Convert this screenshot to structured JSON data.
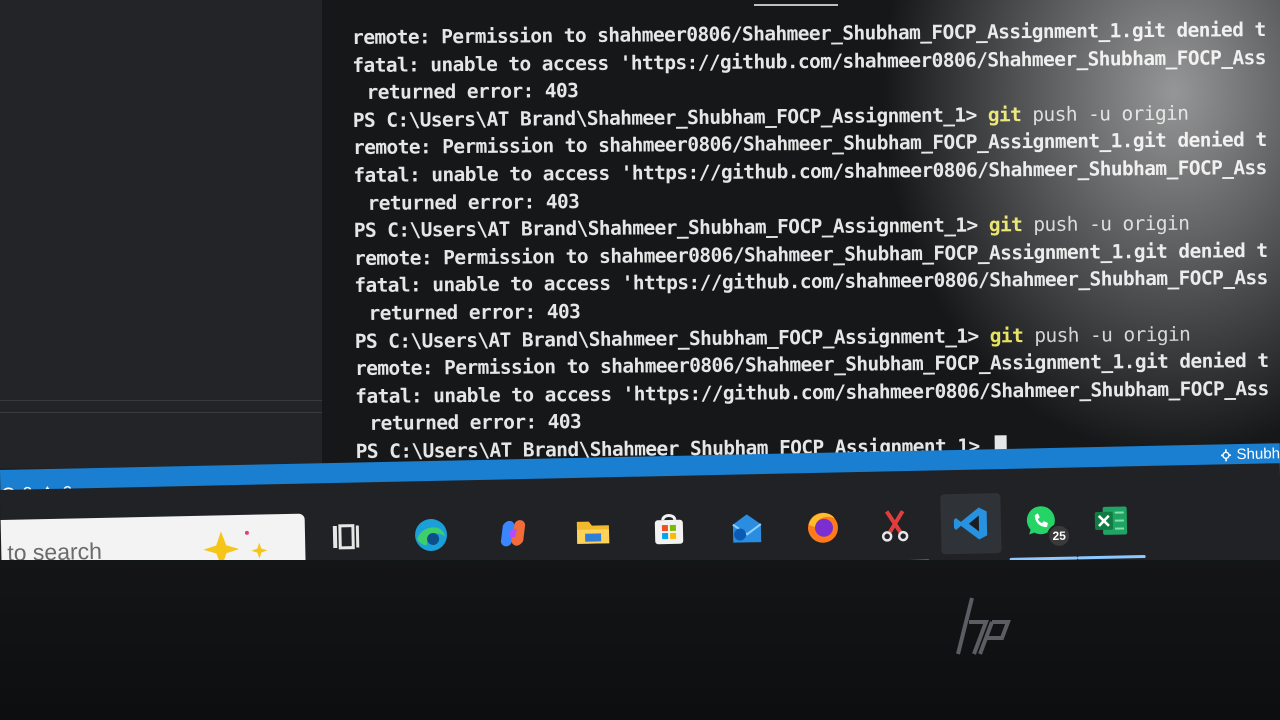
{
  "terminal": {
    "lines": [
      {
        "type": "remote",
        "text": "remote: Permission to shahmeer0806/Shahmeer_Shubham_FOCP_Assignment_1.git denied t"
      },
      {
        "type": "fatal",
        "text": "fatal: unable to access 'https://github.com/shahmeer0806/Shahmeer_Shubham_FOCP_Ass"
      },
      {
        "type": "error",
        "text": "returned error: 403"
      },
      {
        "type": "prompt",
        "prompt": "PS C:\\Users\\AT Brand\\Shahmeer_Shubham_FOCP_Assignment_1> ",
        "keyword": "git",
        "args": " push -u origin"
      },
      {
        "type": "remote",
        "text": "remote: Permission to shahmeer0806/Shahmeer_Shubham_FOCP_Assignment_1.git denied t"
      },
      {
        "type": "fatal",
        "text": "fatal: unable to access 'https://github.com/shahmeer0806/Shahmeer_Shubham_FOCP_Ass"
      },
      {
        "type": "error",
        "text": "returned error: 403"
      },
      {
        "type": "prompt",
        "prompt": "PS C:\\Users\\AT Brand\\Shahmeer_Shubham_FOCP_Assignment_1> ",
        "keyword": "git",
        "args": " push -u origin"
      },
      {
        "type": "remote",
        "text": "remote: Permission to shahmeer0806/Shahmeer_Shubham_FOCP_Assignment_1.git denied t"
      },
      {
        "type": "fatal",
        "text": "fatal: unable to access 'https://github.com/shahmeer0806/Shahmeer_Shubham_FOCP_Ass"
      },
      {
        "type": "error",
        "text": "returned error: 403"
      },
      {
        "type": "prompt",
        "prompt": "PS C:\\Users\\AT Brand\\Shahmeer_Shubham_FOCP_Assignment_1> ",
        "keyword": "git",
        "args": " push -u origin"
      },
      {
        "type": "remote",
        "text": "remote: Permission to shahmeer0806/Shahmeer_Shubham_FOCP_Assignment_1.git denied t"
      },
      {
        "type": "fatal",
        "text": "fatal: unable to access 'https://github.com/shahmeer0806/Shahmeer_Shubham_FOCP_Ass"
      },
      {
        "type": "error",
        "text": "returned error: 403"
      },
      {
        "type": "prompt",
        "prompt": "PS C:\\Users\\AT Brand\\Shahmeer_Shubham_FOCP_Assignment_1> ",
        "keyword": "",
        "args": "",
        "cursor": true
      }
    ]
  },
  "statusbar": {
    "errors_count": "0",
    "warnings_count": "0",
    "branch_label": "Shubh"
  },
  "taskbar": {
    "search_placeholder": "to search",
    "apps": [
      {
        "name": "task-view",
        "icon": "task-view-icon"
      },
      {
        "name": "edge",
        "icon": "edge-icon"
      },
      {
        "name": "copilot",
        "icon": "copilot-icon"
      },
      {
        "name": "file-explorer",
        "icon": "folder-icon"
      },
      {
        "name": "microsoft-store",
        "icon": "store-icon"
      },
      {
        "name": "outlook",
        "icon": "mail-icon"
      },
      {
        "name": "firefox",
        "icon": "firefox-icon"
      },
      {
        "name": "snipping-tool",
        "icon": "scissors-icon"
      },
      {
        "name": "vscode",
        "icon": "vscode-icon",
        "active": true
      },
      {
        "name": "whatsapp",
        "icon": "whatsapp-icon",
        "badge": "25"
      },
      {
        "name": "excel",
        "icon": "excel-icon"
      }
    ]
  },
  "colors": {
    "statusbar": "#1a7fd0",
    "git_keyword": "#e5e15a",
    "terminal_bg": "#161719"
  }
}
